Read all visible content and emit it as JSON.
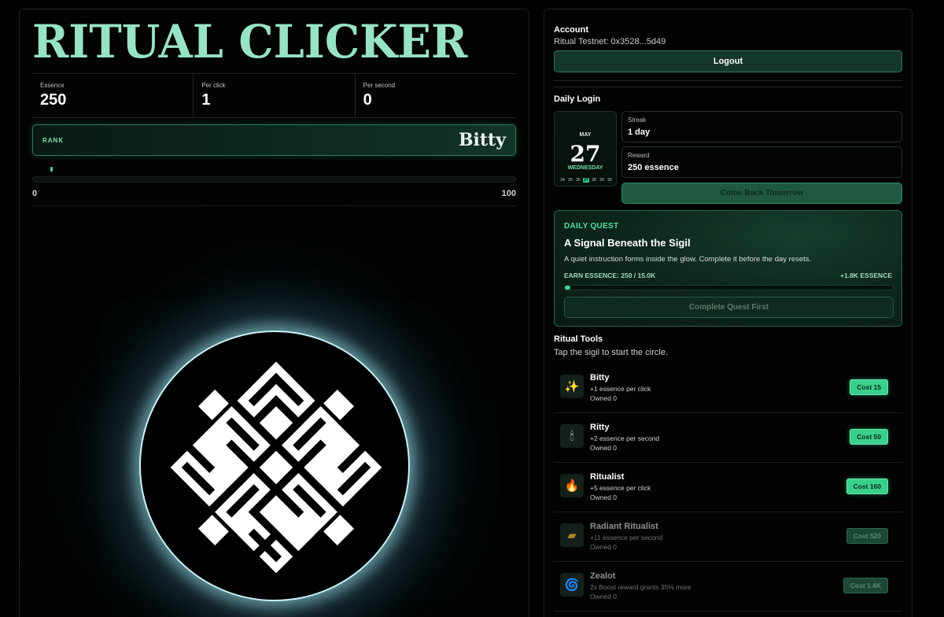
{
  "game": {
    "title": "RITUAL CLICKER",
    "stats": [
      {
        "label": "Essence",
        "value": "250"
      },
      {
        "label": "Per click",
        "value": "1"
      },
      {
        "label": "Per second",
        "value": "0"
      }
    ],
    "rank": {
      "label": "RANK",
      "name": "Bitty"
    },
    "progress": {
      "min": "0",
      "max": "100",
      "value": 0.04
    }
  },
  "account": {
    "title": "Account",
    "network": "Ritual Testnet: 0x3528...5d49",
    "logout_label": "Logout"
  },
  "daily_login": {
    "title": "Daily Login",
    "calendar": {
      "month": "MAY",
      "day": "27",
      "weekday": "WEDNESDAY",
      "week_days": [
        "24",
        "25",
        "26",
        "27",
        "28",
        "29",
        "30"
      ],
      "active_day": "27"
    },
    "streak_label": "Streak",
    "streak_value": "1 day",
    "reward_label": "Reward",
    "reward_value": "250 essence",
    "button_label": "Come Back Tomorrow"
  },
  "daily_quest": {
    "tag": "DAILY QUEST",
    "title": "A Signal Beneath the Sigil",
    "description": "A quiet instruction forms inside the glow. Complete it before the day resets.",
    "earn_text": "EARN ESSENCE: 250 / 15.0K",
    "reward_text": "+1.8K ESSENCE",
    "progress": 0.017,
    "button_label": "Complete Quest First"
  },
  "tools": {
    "title": "Ritual Tools",
    "subtitle": "Tap the sigil to start the circle.",
    "items": [
      {
        "name": "Bitty",
        "desc": "+1 essence per click",
        "owned": "Owned 0",
        "cost": "Cost 15",
        "icon": "wand-icon",
        "glyph": "✨",
        "affordable": true
      },
      {
        "name": "Ritty",
        "desc": "+2 essence per second",
        "owned": "Owned 0",
        "cost": "Cost 50",
        "icon": "candle-icon",
        "glyph": "🕯",
        "affordable": true
      },
      {
        "name": "Ritualist",
        "desc": "+5 essence per click",
        "owned": "Owned 0",
        "cost": "Cost 160",
        "icon": "flame-icon",
        "glyph": "🔥",
        "affordable": true
      },
      {
        "name": "Radiant Ritualist",
        "desc": "+11 essence per second",
        "owned": "Owned 0",
        "cost": "Cost 520",
        "icon": "scroll-icon",
        "glyph": "▰",
        "affordable": false
      },
      {
        "name": "Zealot",
        "desc": "2x Boost reward grants 35% more",
        "owned": "Owned 0",
        "cost": "Cost 1.4K",
        "icon": "spiral-icon",
        "glyph": "🌀",
        "affordable": false
      }
    ]
  }
}
